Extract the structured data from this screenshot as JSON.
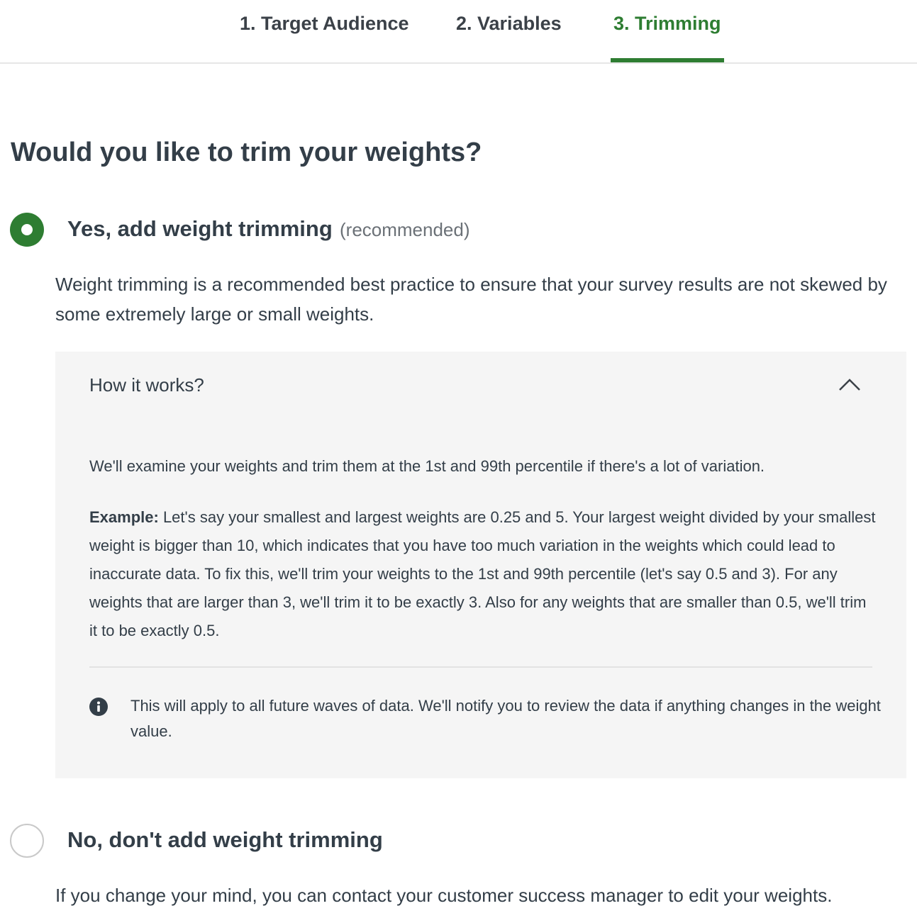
{
  "tabs": [
    {
      "label": "1. Target Audience",
      "active": false
    },
    {
      "label": "2. Variables",
      "active": false
    },
    {
      "label": "3. Trimming",
      "active": true
    }
  ],
  "colors": {
    "accent": "#2e7d32",
    "panel_bg": "#f5f5f5",
    "text": "#333e48"
  },
  "question": "Would you like to trim your weights?",
  "option_yes": {
    "label": "Yes, add weight trimming",
    "tag": "(recommended)",
    "selected": true,
    "description": "Weight trimming is a recommended best practice to ensure that your survey results are not skewed by some extremely large or small weights."
  },
  "how_it_works": {
    "title": "How it works?",
    "expanded": true,
    "paragraph": "We'll examine your weights and trim them at the 1st and 99th percentile if there's a lot of variation.",
    "example_label": "Example:",
    "example_text": " Let's say your smallest and largest weights are 0.25 and 5. Your largest weight divided by your smallest weight is bigger than 10, which indicates that you have too much variation in the weights which could lead to inaccurate data. To fix this, we'll trim your weights to the 1st and 99th percentile (let's say 0.5 and 3). For any weights that are larger than 3, we'll trim it to be exactly 3. Also for any weights that are smaller than 0.5, we'll trim it to be exactly 0.5.",
    "info_icon": "info-icon",
    "info_text": "This will apply to all future waves of data. We'll notify you to review the data if anything changes in the weight value."
  },
  "option_no": {
    "label": "No, don't add weight trimming",
    "selected": false,
    "description": "If you change your mind, you can contact your customer success manager to edit your weights."
  }
}
